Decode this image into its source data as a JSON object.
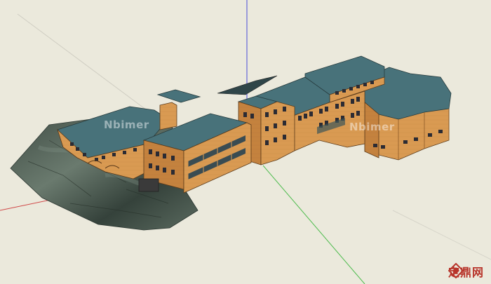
{
  "watermarks": {
    "left": "Nbimer",
    "right": "Nbimer"
  },
  "brand": {
    "name": "定鼎网",
    "icon": "diamond-logo-icon",
    "color": "#b8352b"
  },
  "colors": {
    "background": "#ebe9dc",
    "brick_front": "#d99a52",
    "brick_side": "#c4823e",
    "roof": "#48727a",
    "terrain": "#4a5a50",
    "axis_red": "#d04848",
    "axis_green": "#4cbb4c",
    "axis_blue": "#4a4ad8"
  }
}
